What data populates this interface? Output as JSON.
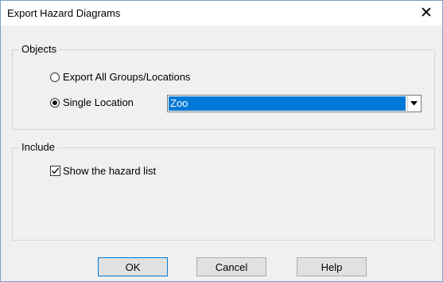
{
  "window": {
    "title": "Export Hazard Diagrams",
    "close_glyph": "✕"
  },
  "objects": {
    "label": "Objects",
    "option_all_label": "Export All Groups/Locations",
    "option_all_selected": false,
    "option_single_label": "Single Location",
    "option_single_selected": true,
    "location_value": "Zoo"
  },
  "include": {
    "label": "Include",
    "show_hazard_list_label": "Show the hazard list",
    "show_hazard_list_checked": true
  },
  "buttons": {
    "ok": "OK",
    "cancel": "Cancel",
    "help": "Help"
  },
  "colors": {
    "selection": "#0078d7",
    "default_button_border": "#0078d7"
  }
}
